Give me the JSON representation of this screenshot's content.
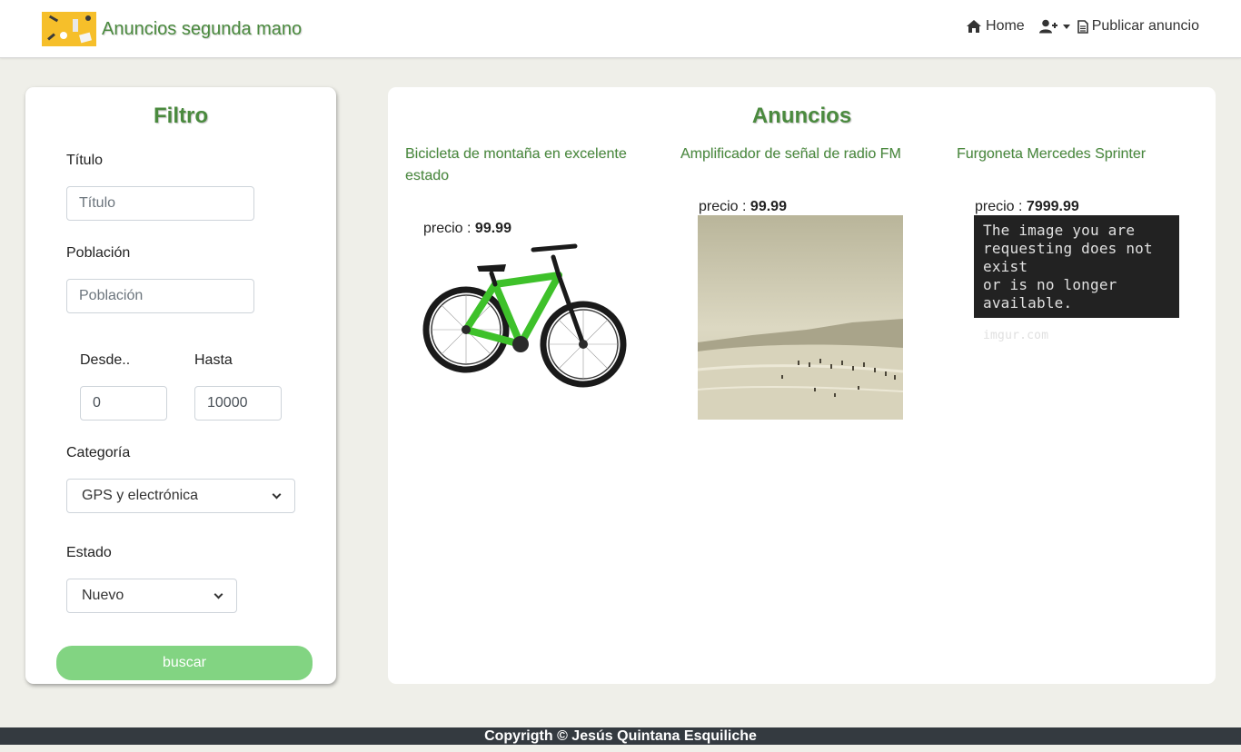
{
  "navbar": {
    "brand": "Anuncios segunda mano",
    "home_label": "Home",
    "publish_label": "Publicar anuncio"
  },
  "filter": {
    "title": "Filtro",
    "titulo_label": "Título",
    "titulo_placeholder": "Título",
    "poblacion_label": "Población",
    "poblacion_placeholder": "Población",
    "desde_label": "Desde..",
    "desde_value": "0",
    "hasta_label": "Hasta",
    "hasta_value": "10000",
    "categoria_label": "Categoría",
    "categoria_value": "GPS y electrónica",
    "estado_label": "Estado",
    "estado_value": "Nuevo",
    "search_label": "buscar"
  },
  "ads": {
    "title": "Anuncios",
    "price_prefix": "precio : ",
    "items": [
      {
        "title": "Bicicleta de montaña en excelente estado",
        "price": "99.99",
        "image": "green mountain bike"
      },
      {
        "title": "Amplificador de señal de radio FM",
        "price": "99.99",
        "image": "hazy beach photo"
      },
      {
        "title": "Furgoneta Mercedes Sprinter",
        "price": "7999.99",
        "image": "imgur placeholder"
      }
    ],
    "imgur_line1": "The image you are",
    "imgur_line2": "requesting does not exist",
    "imgur_line3": "or is no longer available.",
    "imgur_domain": "imgur.com"
  },
  "footer": {
    "text": "Copyrigth © Jesús Quintana Esquiliche"
  },
  "colors": {
    "accent_green": "#4a8a3e",
    "button_green": "#82d482",
    "footer_bg": "#343a40",
    "page_bg": "#efefe9"
  }
}
